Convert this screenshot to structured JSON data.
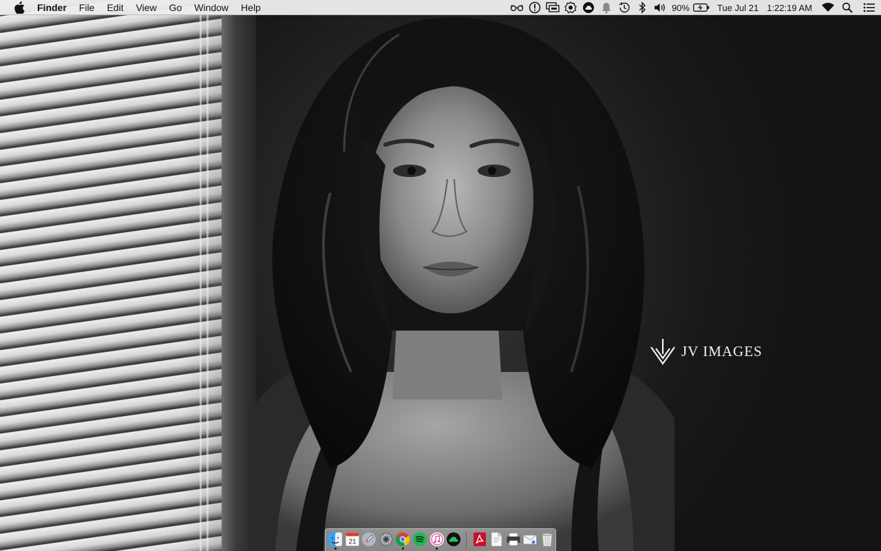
{
  "menubar": {
    "app_name": "Finder",
    "menus": [
      "File",
      "Edit",
      "View",
      "Go",
      "Window",
      "Help"
    ],
    "status_icons": [
      "glasses-icon",
      "alert-icon",
      "display-mirror-icon",
      "gear-badge-icon",
      "creative-cloud-icon",
      "notification-bell-icon",
      "time-machine-icon",
      "bluetooth-icon",
      "volume-icon"
    ],
    "battery_percent": "90%",
    "date": "Tue Jul 21",
    "time": "1:22:19 AM",
    "right_icons": [
      "wifi-icon",
      "spotlight-search-icon",
      "notification-center-icon"
    ]
  },
  "wallpaper": {
    "watermark": "JV IMAGES"
  },
  "dock": {
    "calendar_date": "21",
    "running_indicators": [
      "finder",
      "chrome",
      "itunes"
    ],
    "items": [
      "finder",
      "calendar",
      "launchpad",
      "system-preferences",
      "chrome",
      "spotify",
      "itunes",
      "creative-cloud",
      "acrobat",
      "preview-document",
      "printer",
      "mail",
      "trash"
    ]
  }
}
